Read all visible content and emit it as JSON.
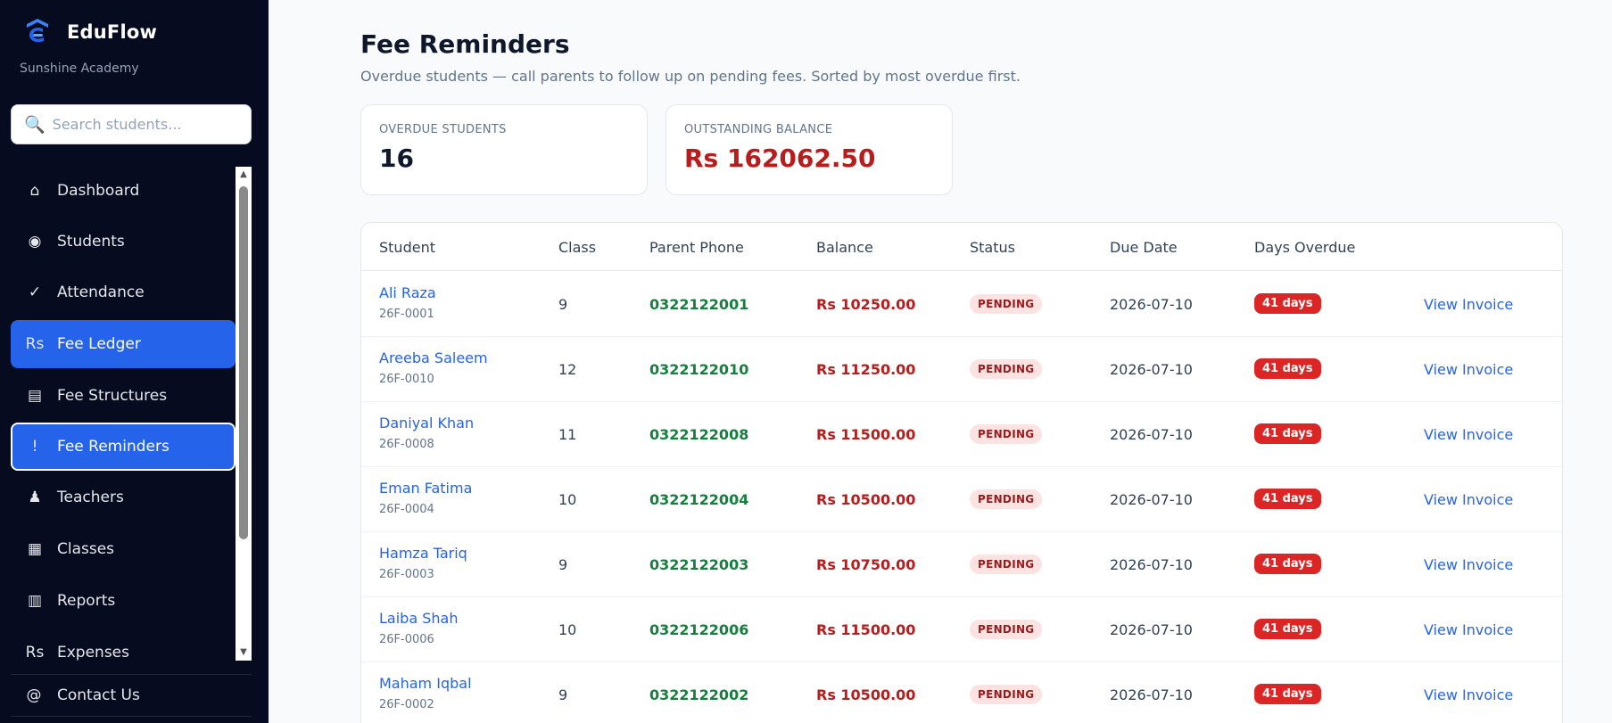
{
  "sidebar": {
    "brand": "EduFlow",
    "school": "Sunshine Academy",
    "search_placeholder": "Search students...",
    "items": [
      {
        "icon": "⌂",
        "label": "Dashboard"
      },
      {
        "icon": "◉",
        "label": "Students"
      },
      {
        "icon": "✓",
        "label": "Attendance"
      },
      {
        "icon": "Rs",
        "label": "Fee Ledger"
      },
      {
        "icon": "▤",
        "label": "Fee Structures"
      },
      {
        "icon": "!",
        "label": "Fee Reminders"
      },
      {
        "icon": "♟",
        "label": "Teachers"
      },
      {
        "icon": "▦",
        "label": "Classes"
      },
      {
        "icon": "▥",
        "label": "Reports"
      },
      {
        "icon": "Rs",
        "label": "Expenses"
      }
    ],
    "contact": {
      "icon": "@",
      "label": "Contact Us"
    }
  },
  "page": {
    "title": "Fee Reminders",
    "subtitle": "Overdue students — call parents to follow up on pending fees. Sorted by most overdue first."
  },
  "stats": {
    "overdue_label": "OVERDUE STUDENTS",
    "overdue_value": "16",
    "balance_label": "OUTSTANDING BALANCE",
    "balance_value": "Rs 162062.50"
  },
  "table": {
    "headers": [
      "Student",
      "Class",
      "Parent Phone",
      "Balance",
      "Status",
      "Due Date",
      "Days Overdue"
    ],
    "rows": [
      {
        "name": "Ali Raza",
        "id": "26F-0001",
        "class": "9",
        "phone": "0322122001",
        "balance": "Rs 10250.00",
        "status": "PENDING",
        "due": "2026-07-10",
        "days": "41 days",
        "action": "View Invoice"
      },
      {
        "name": "Areeba Saleem",
        "id": "26F-0010",
        "class": "12",
        "phone": "0322122010",
        "balance": "Rs 11250.00",
        "status": "PENDING",
        "due": "2026-07-10",
        "days": "41 days",
        "action": "View Invoice"
      },
      {
        "name": "Daniyal Khan",
        "id": "26F-0008",
        "class": "11",
        "phone": "0322122008",
        "balance": "Rs 11500.00",
        "status": "PENDING",
        "due": "2026-07-10",
        "days": "41 days",
        "action": "View Invoice"
      },
      {
        "name": "Eman Fatima",
        "id": "26F-0004",
        "class": "10",
        "phone": "0322122004",
        "balance": "Rs 10500.00",
        "status": "PENDING",
        "due": "2026-07-10",
        "days": "41 days",
        "action": "View Invoice"
      },
      {
        "name": "Hamza Tariq",
        "id": "26F-0003",
        "class": "9",
        "phone": "0322122003",
        "balance": "Rs 10750.00",
        "status": "PENDING",
        "due": "2026-07-10",
        "days": "41 days",
        "action": "View Invoice"
      },
      {
        "name": "Laiba Shah",
        "id": "26F-0006",
        "class": "10",
        "phone": "0322122006",
        "balance": "Rs 11500.00",
        "status": "PENDING",
        "due": "2026-07-10",
        "days": "41 days",
        "action": "View Invoice"
      },
      {
        "name": "Maham Iqbal",
        "id": "26F-0002",
        "class": "9",
        "phone": "0322122002",
        "balance": "Rs 10500.00",
        "status": "PENDING",
        "due": "2026-07-10",
        "days": "41 days",
        "action": "View Invoice"
      }
    ]
  },
  "colors": {
    "sidebar_bg": "#060b1f",
    "accent": "#2563eb",
    "danger": "#dc2626",
    "phone_green": "#15803d"
  }
}
